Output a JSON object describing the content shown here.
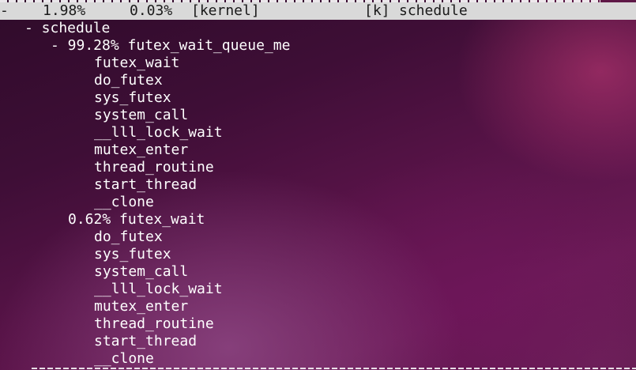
{
  "header": {
    "marker": "-",
    "children": "1.98%",
    "self": "0.03%",
    "shared_object": "[kernel]",
    "type": "[k]",
    "symbol": "schedule"
  },
  "tree": [
    {
      "text": "- schedule"
    },
    {
      "text": "- 99.28% futex_wait_queue_me"
    },
    {
      "text": "futex_wait"
    },
    {
      "text": "do_futex"
    },
    {
      "text": "sys_futex"
    },
    {
      "text": "system_call"
    },
    {
      "text": "__lll_lock_wait"
    },
    {
      "text": "mutex_enter"
    },
    {
      "text": "thread_routine"
    },
    {
      "text": "start_thread"
    },
    {
      "text": "__clone"
    },
    {
      "text": "0.62% futex_wait"
    },
    {
      "text": "do_futex"
    },
    {
      "text": "sys_futex"
    },
    {
      "text": "system_call"
    },
    {
      "text": "__lll_lock_wait"
    },
    {
      "text": "mutex_enter"
    },
    {
      "text": "thread_routine"
    },
    {
      "text": "start_thread"
    },
    {
      "text": "__clone"
    }
  ],
  "colors": {
    "header_bg": "#d9d9d9",
    "header_fg": "#1a1a1a",
    "text": "#ffffff"
  }
}
